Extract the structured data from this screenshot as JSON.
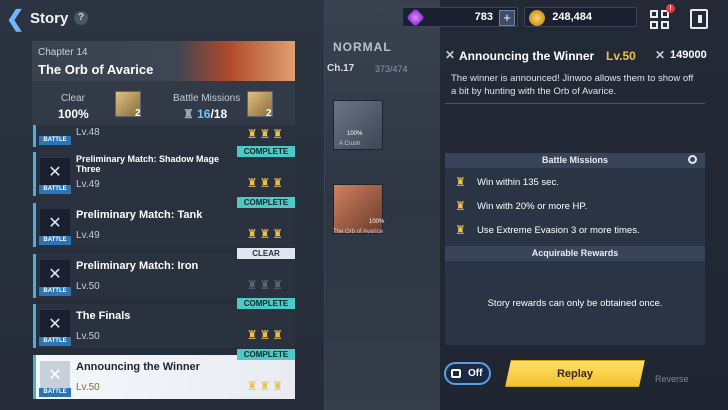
{
  "header": {
    "back_glyph": "❮",
    "title": "Story",
    "help_glyph": "?"
  },
  "currencies": [
    {
      "icon": "gem-icon",
      "value": "783",
      "plus": "+"
    },
    {
      "icon": "coin-icon",
      "value": "248,484"
    }
  ],
  "notification_count": "!",
  "chapter": {
    "number": "Chapter 14",
    "name": "The Orb of Avarice",
    "clear_label": "Clear",
    "clear_value": "100%",
    "battle_missions_label": "Battle Missions",
    "battle_missions_done": "16",
    "battle_missions_total": "/18",
    "badge_clear_count": "2",
    "badge_mission_count": "2"
  },
  "missions": [
    {
      "name": "",
      "level": "Lv.48",
      "status": "",
      "trophies": 3,
      "tag": "BATTLE"
    },
    {
      "name": "Preliminary Match: Shadow Mage Three",
      "level": "Lv.49",
      "status": "COMPLETE",
      "trophies": 3,
      "tag": "BATTLE"
    },
    {
      "name": "Preliminary Match: Tank",
      "level": "Lv.49",
      "status": "COMPLETE",
      "trophies": 3,
      "tag": "BATTLE"
    },
    {
      "name": "Preliminary Match: Iron",
      "level": "Lv.50",
      "status": "CLEAR",
      "trophies": 0,
      "tag": "BATTLE"
    },
    {
      "name": "The Finals",
      "level": "Lv.50",
      "status": "COMPLETE",
      "trophies": 3,
      "tag": "BATTLE"
    },
    {
      "name": "Announcing the Winner",
      "level": "Lv.50",
      "status": "COMPLETE",
      "trophies": 3,
      "tag": "BATTLE",
      "selected": true
    }
  ],
  "preview": {
    "mode": "NORMAL",
    "chapter": "Ch.17",
    "progress": "373/474",
    "cards": [
      {
        "caption": "A Crush",
        "pct": "100%"
      },
      {
        "caption": "The Orb of Avarice",
        "pct": "100%"
      }
    ]
  },
  "detail": {
    "title": "Announcing the Winner",
    "level": "Lv.50",
    "power": "149000",
    "description": "The winner is announced! Jinwoo allows them to show off a bit by hunting with the Orb of Avarice.",
    "battle_missions_header": "Battle Missions",
    "battle_missions": [
      "Win within 135 sec.",
      "Win with 20% or more HP.",
      "Use Extreme Evasion 3 or more times."
    ],
    "rewards_header": "Acquirable Rewards",
    "rewards_note": "Story rewards can only be obtained once."
  },
  "controls": {
    "auto_toggle": "Off",
    "replay": "Replay",
    "reverse": "Reverse"
  }
}
